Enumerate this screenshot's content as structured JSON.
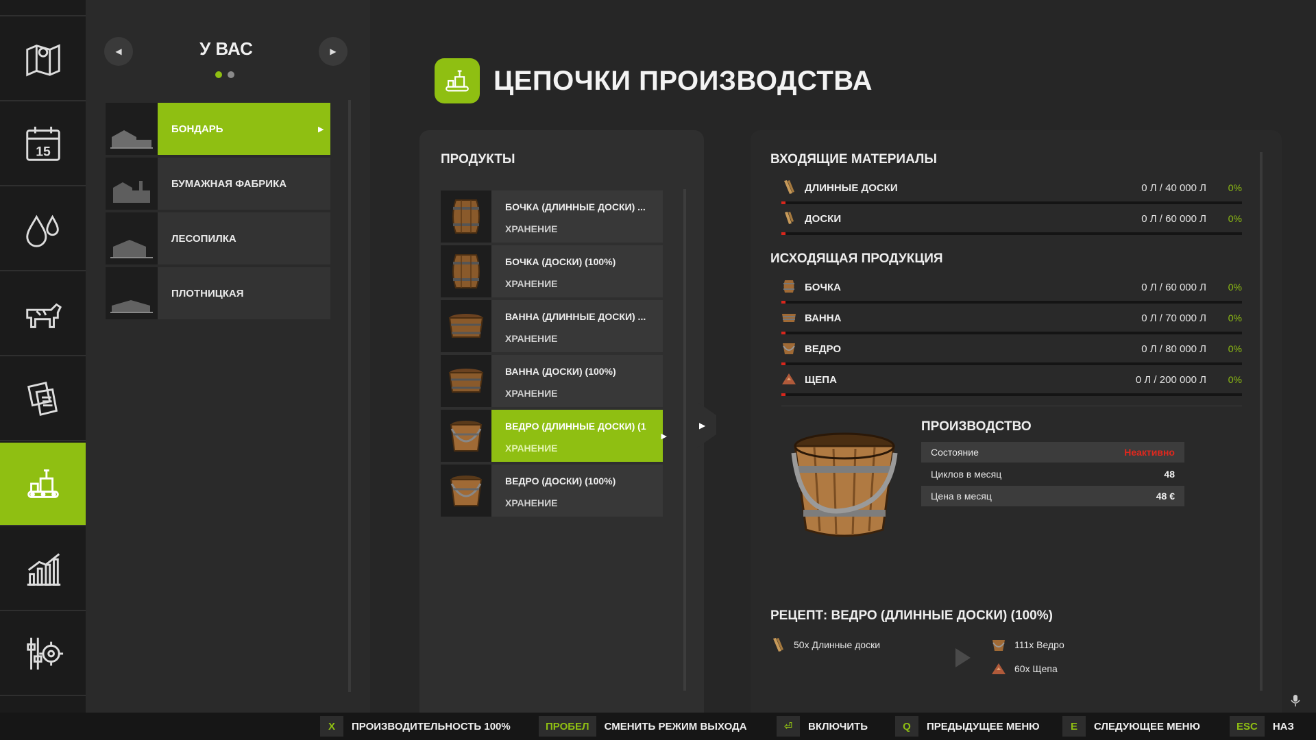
{
  "nav": {
    "items": [
      {
        "icon": "map-icon"
      },
      {
        "icon": "calendar-icon",
        "label": "15"
      },
      {
        "icon": "weather-drops-icon"
      },
      {
        "icon": "animals-cow-icon"
      },
      {
        "icon": "contracts-icon"
      },
      {
        "icon": "production-icon",
        "active": true
      },
      {
        "icon": "statistics-icon"
      },
      {
        "icon": "settings-icon"
      }
    ]
  },
  "facilities": {
    "title": "У ВАС",
    "page_dots": 2,
    "active_page": 0,
    "items": [
      {
        "label": "БОНДАРЬ",
        "active": true
      },
      {
        "label": "БУМАЖНАЯ ФАБРИКА"
      },
      {
        "label": "ЛЕСОПИЛКА"
      },
      {
        "label": "ПЛОТНИЦКАЯ"
      }
    ]
  },
  "header": {
    "title": "ЦЕПОЧКИ ПРОИЗВОДСТВА"
  },
  "products": {
    "title": "ПРОДУКТЫ",
    "items": [
      {
        "name": "БОЧКА (ДЛИННЫЕ ДОСКИ) ...",
        "sub": "ХРАНЕНИЕ",
        "icon": "barrel-icon"
      },
      {
        "name": "БОЧКА (ДОСКИ) (100%)",
        "sub": "ХРАНЕНИЕ",
        "icon": "barrel-icon"
      },
      {
        "name": "ВАННА (ДЛИННЫЕ ДОСКИ) ...",
        "sub": "ХРАНЕНИЕ",
        "icon": "tub-icon"
      },
      {
        "name": "ВАННА (ДОСКИ) (100%)",
        "sub": "ХРАНЕНИЕ",
        "icon": "tub-icon"
      },
      {
        "name": "ВЕДРО (ДЛИННЫЕ ДОСКИ) (1",
        "sub": "ХРАНЕНИЕ",
        "icon": "bucket-icon",
        "active": true
      },
      {
        "name": "ВЕДРО (ДОСКИ) (100%)",
        "sub": "ХРАНЕНИЕ",
        "icon": "bucket-icon"
      }
    ]
  },
  "inputs": {
    "title": "ВХОДЯЩИЕ МАТЕРИАЛЫ",
    "items": [
      {
        "name": "ДЛИННЫЕ ДОСКИ",
        "value": "0 Л / 40 000 Л",
        "percent": "0%",
        "fill": 0
      },
      {
        "name": "ДОСКИ",
        "value": "0 Л / 60 000 Л",
        "percent": "0%",
        "fill": 0
      }
    ]
  },
  "outputs": {
    "title": "ИСХОДЯЩАЯ ПРОДУКЦИЯ",
    "items": [
      {
        "name": "БОЧКА",
        "value": "0 Л / 60 000 Л",
        "percent": "0%",
        "fill": 0
      },
      {
        "name": "ВАННА",
        "value": "0 Л / 70 000 Л",
        "percent": "0%",
        "fill": 0
      },
      {
        "name": "ВЕДРО",
        "value": "0 Л / 80 000 Л",
        "percent": "0%",
        "fill": 0
      },
      {
        "name": "ЩЕПА",
        "value": "0 Л / 200 000 Л",
        "percent": "0%",
        "fill": 0
      }
    ]
  },
  "production": {
    "title": "ПРОИЗВОДСТВО",
    "rows": [
      {
        "key": "Состояние",
        "value": "Неактивно"
      },
      {
        "key": "Циклов в месяц",
        "value": "48"
      },
      {
        "key": "Цена в месяц",
        "value": "48 €"
      }
    ]
  },
  "recipe": {
    "title": "РЕЦЕПТ: ВЕДРО (ДЛИННЫЕ ДОСКИ) (100%)",
    "inputs": [
      {
        "text": "50x Длинные доски"
      }
    ],
    "outputs": [
      {
        "text": "111x Ведро"
      },
      {
        "text": "60x Щепа"
      }
    ]
  },
  "bottom_bar": {
    "actions": [
      {
        "key": "X",
        "label": "ПРОИЗВОДИТЕЛЬНОСТЬ 100%"
      },
      {
        "key": "ПРОБЕЛ",
        "label": "СМЕНИТЬ РЕЖИМ ВЫХОДА"
      },
      {
        "key": "⏎",
        "label": "ВКЛЮЧИТЬ"
      },
      {
        "key": "Q",
        "label": "ПРЕДЫДУЩЕЕ МЕНЮ"
      },
      {
        "key": "E",
        "label": "СЛЕДУЮЩЕЕ МЕНЮ"
      },
      {
        "key": "ESC",
        "label": "НАЗ"
      }
    ]
  },
  "colors": {
    "accent": "#8fbf12",
    "warning": "#e0281e",
    "bg": "#262626"
  }
}
